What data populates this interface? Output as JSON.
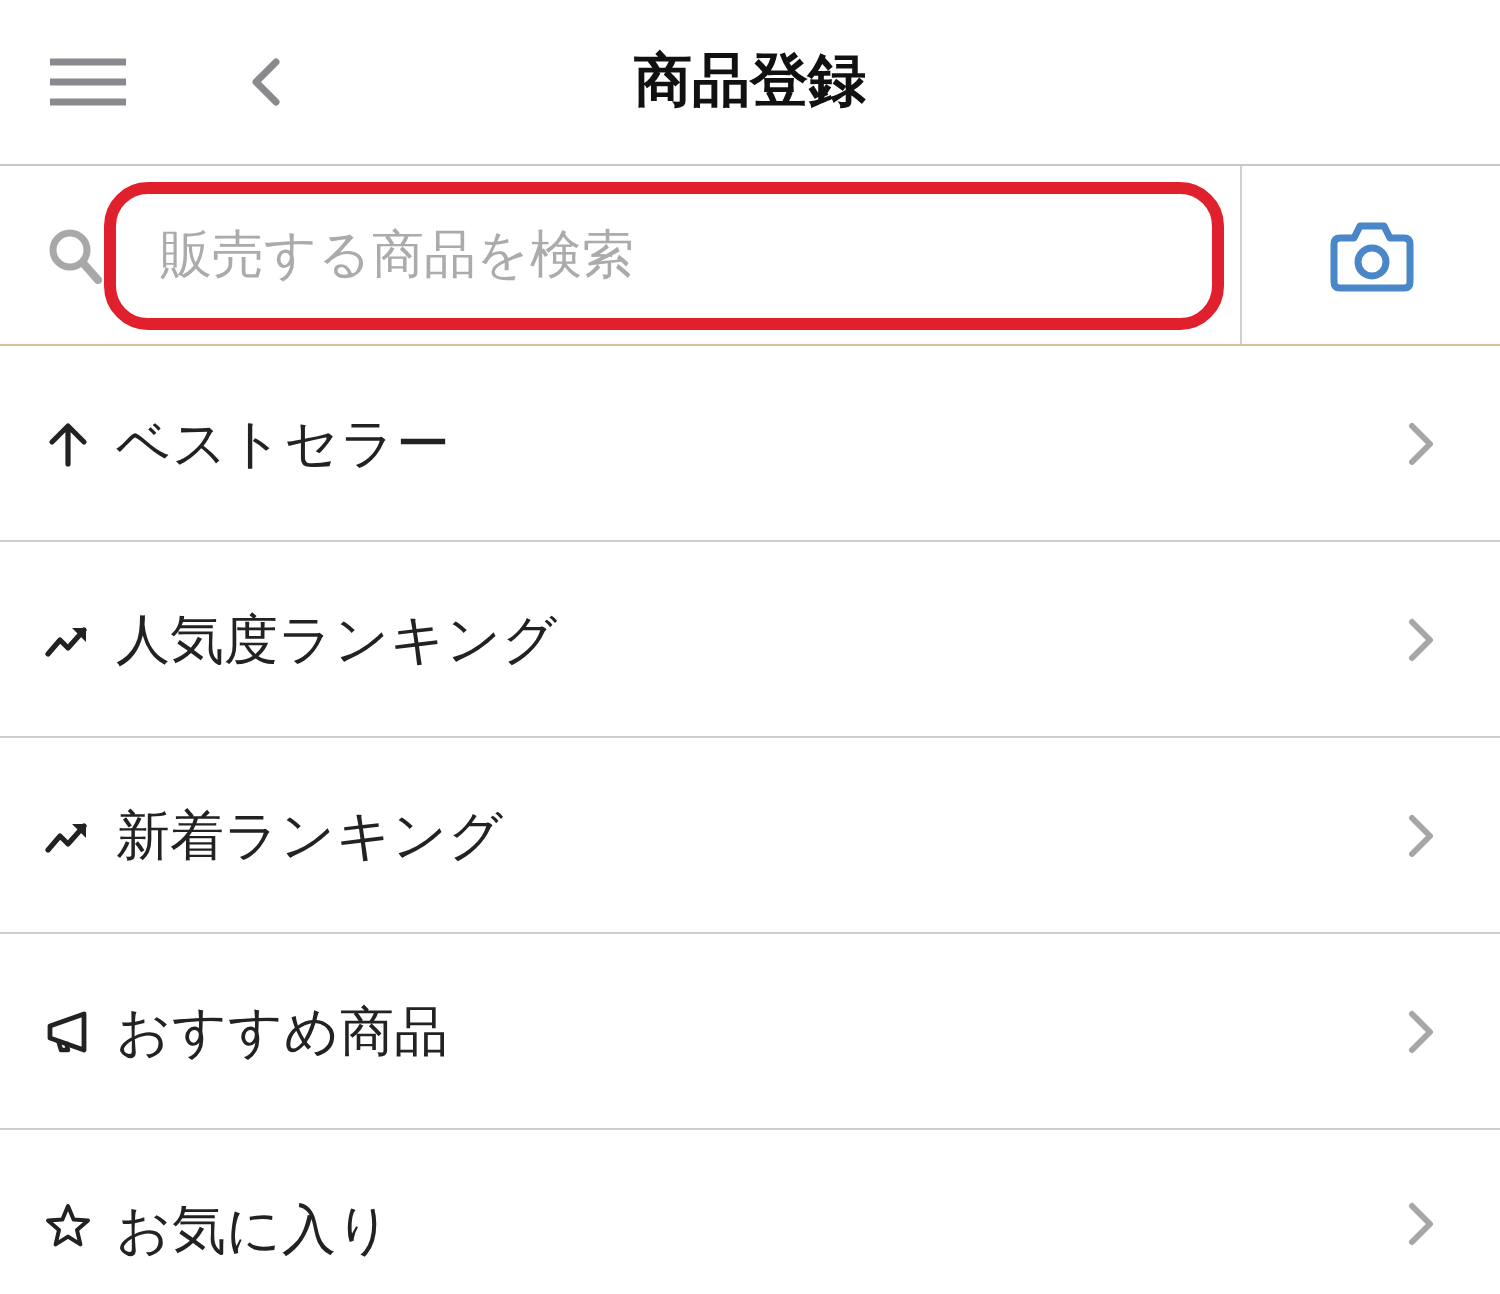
{
  "header": {
    "title": "商品登録"
  },
  "search": {
    "placeholder": "販売する商品を検索",
    "highlighted": true
  },
  "menu": [
    {
      "kind": "bestseller",
      "label": "ベストセラー"
    },
    {
      "kind": "ranking",
      "label": "人気度ランキング"
    },
    {
      "kind": "ranking",
      "label": "新着ランキング"
    },
    {
      "kind": "recommended",
      "label": "おすすめ商品"
    },
    {
      "kind": "favorite",
      "label": "お気に入り"
    }
  ]
}
